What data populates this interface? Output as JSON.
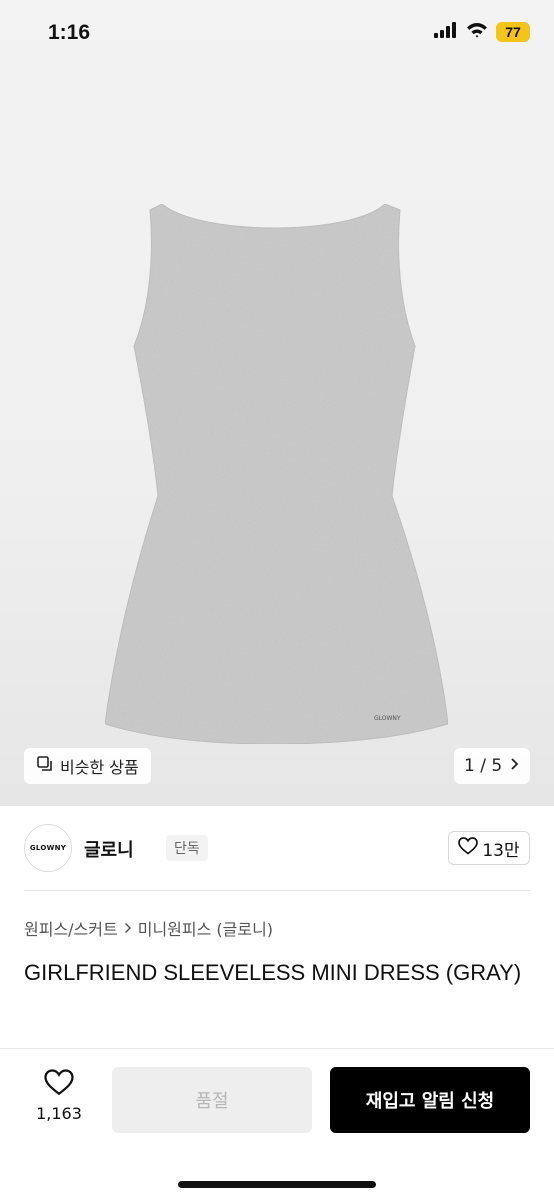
{
  "status_bar": {
    "time": "1:16",
    "battery": "77",
    "battery_color": "#f4c417",
    "icons": [
      "signal-icon",
      "wifi-icon",
      "battery-icon"
    ]
  },
  "gallery": {
    "similar_label": "비슷한 상품",
    "similar_icon": "copy-icon",
    "page_indicator": "1 / 5",
    "product_label": "GLOWNY"
  },
  "brand": {
    "logo_text": "GLOWNY",
    "name": "글로니",
    "badge": "단독",
    "likes": "13만"
  },
  "product": {
    "breadcrumb": [
      "원피스/스커트",
      "미니원피스 (글로니)"
    ],
    "title": "GIRLFRIEND SLEEVELESS MINI DRESS (GRAY)"
  },
  "bottom": {
    "wish_count": "1,163",
    "soldout_label": "품절",
    "restock_label": "재입고 알림 신청",
    "accent": "#000000"
  }
}
